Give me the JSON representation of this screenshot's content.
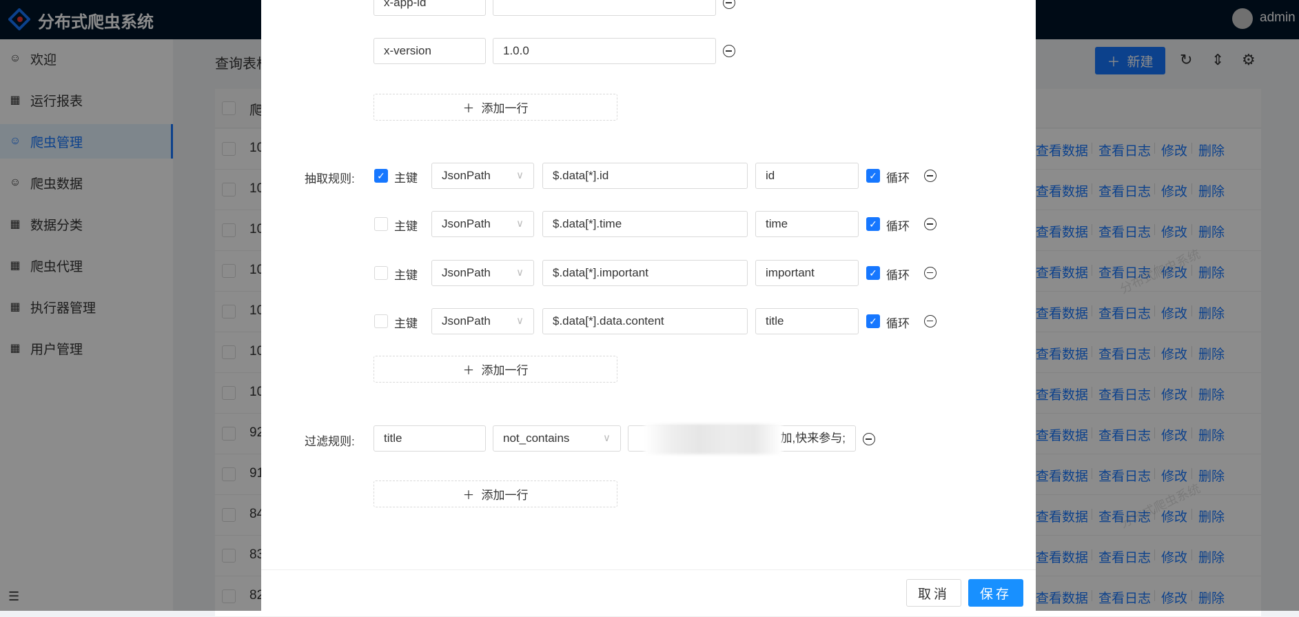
{
  "header": {
    "app_title": "分布式爬虫系统",
    "user": "admin"
  },
  "sidebar": {
    "items": [
      {
        "label": "欢迎",
        "icon": "smile-icon"
      },
      {
        "label": "运行报表",
        "icon": "table-icon"
      },
      {
        "label": "爬虫管理",
        "icon": "smile-icon",
        "active": true
      },
      {
        "label": "爬虫数据",
        "icon": "smile-icon"
      },
      {
        "label": "数据分类",
        "icon": "table-icon"
      },
      {
        "label": "爬虫代理",
        "icon": "table-icon"
      },
      {
        "label": "执行器管理",
        "icon": "table-icon"
      },
      {
        "label": "用户管理",
        "icon": "table-icon"
      }
    ]
  },
  "page": {
    "table_title": "查询表格",
    "new_label": "新建",
    "header_first_col": "爬",
    "watermark": "分布式爬虫系统",
    "rows": [
      "10",
      "10",
      "10",
      "10",
      "10",
      "10",
      "10",
      "92",
      "91",
      "84",
      "83",
      "82"
    ],
    "actions": [
      "查看数据",
      "查看日志",
      "修改",
      "删除"
    ]
  },
  "modal": {
    "headers": [
      {
        "key": "x-app-id",
        "value": ""
      },
      {
        "key": "x-version",
        "value": "1.0.0"
      }
    ],
    "add_row": "添加一行",
    "extract_label": "抽取规则:",
    "primary_label": "主键",
    "loop_label": "循环",
    "extract_rules": [
      {
        "primary": true,
        "type": "JsonPath",
        "path": "$.data[*].id",
        "name": "id",
        "loop": true
      },
      {
        "primary": false,
        "type": "JsonPath",
        "path": "$.data[*].time",
        "name": "time",
        "loop": true
      },
      {
        "primary": false,
        "type": "JsonPath",
        "path": "$.data[*].important",
        "name": "important",
        "loop": true
      },
      {
        "primary": false,
        "type": "JsonPath",
        "path": "$.data[*].data.content",
        "name": "title",
        "loop": true
      }
    ],
    "filter_label": "过滤规则:",
    "filter": {
      "field": "title",
      "op": "not_contains",
      "value_visible": "加,快来参与;"
    },
    "cancel": "取消",
    "save": "保存"
  },
  "colors": {
    "primary": "#1677ff",
    "header_bg": "#001529"
  }
}
